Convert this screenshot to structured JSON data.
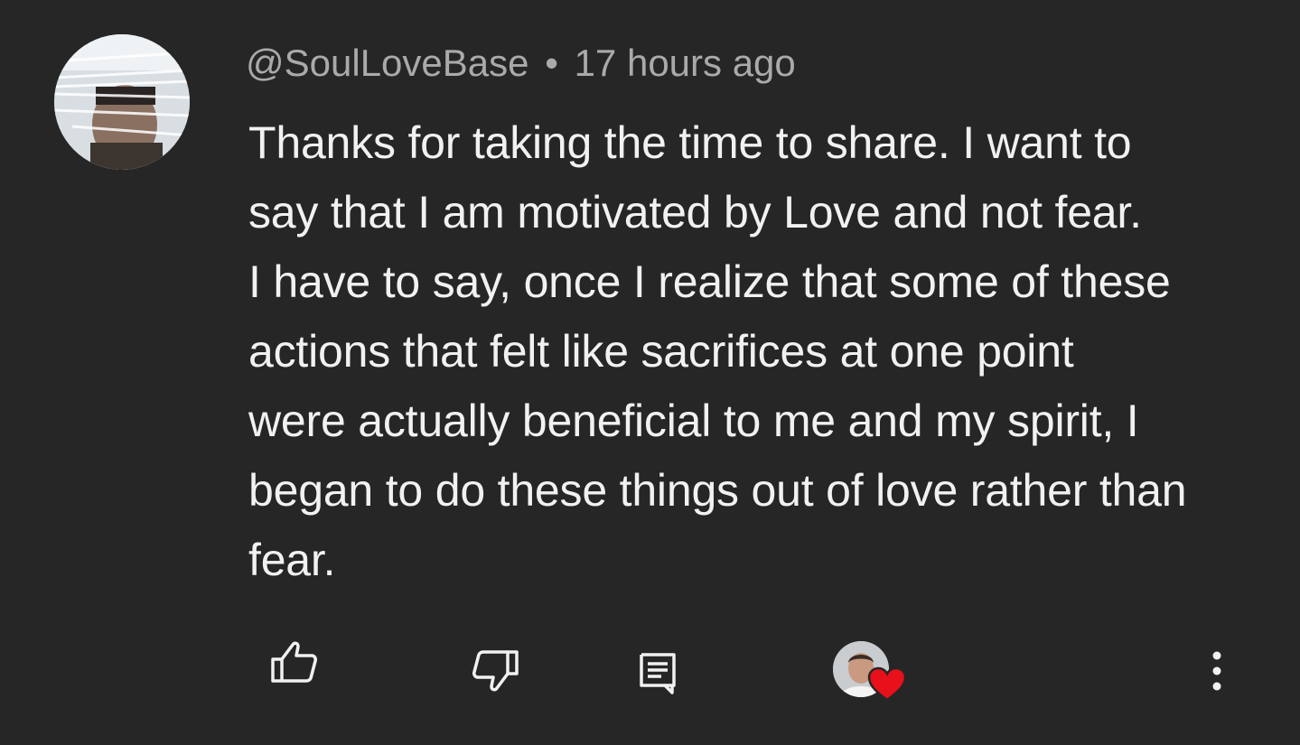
{
  "comment": {
    "author": "@SoulLoveBase",
    "separator": "•",
    "timestamp": "17 hours ago",
    "text_lines": [
      "Thanks for taking the time to share. I want to",
      "say that I am motivated by Love and not fear.",
      "I have to say, once I realize that some of these",
      "actions that felt like sacrifices at one point",
      "were actually beneficial to me and my spirit, I",
      "began to do these things out of love rather than",
      "fear."
    ]
  },
  "actions": {
    "like_icon": "thumbs-up-icon",
    "dislike_icon": "thumbs-down-icon",
    "reply_icon": "reply-comment-icon",
    "hearted_icon": "creator-heart-icon",
    "more_icon": "more-vertical-icon"
  },
  "colors": {
    "background": "#262626",
    "text_primary": "#f1f1f1",
    "text_secondary": "#aaaaaa",
    "heart": "#e8101a"
  }
}
